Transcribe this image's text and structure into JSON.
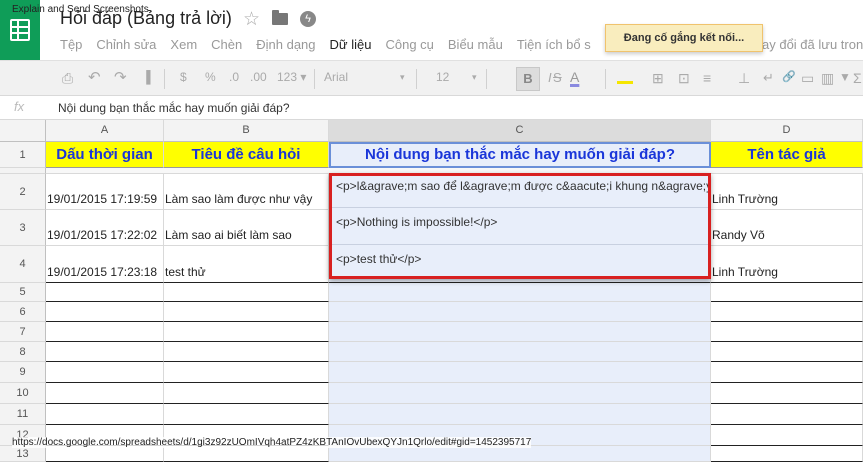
{
  "overlay_title": "Explain and Send Screenshots",
  "doc_title": "Hỏi đáp (Bảng trả lời)",
  "menu": [
    "Tệp",
    "Chỉnh sửa",
    "Xem",
    "Chèn",
    "Định dạng",
    "Dữ liệu",
    "Công cụ",
    "Biểu mẫu",
    "Tiện ích bổ s"
  ],
  "menu_active_index": 5,
  "menu_last": "ay đổi đã lưu trong",
  "toast": "Đang cố gắng kết nối...",
  "toolbar": {
    "print": "⎙",
    "undo": "↶",
    "redo": "↷",
    "paint": "▐",
    "currency": "$",
    "percent": "%",
    "dec_less": ".0",
    "dec_more": ".00",
    "format": "123 ▾",
    "font": "Arial",
    "font_dd": "▾",
    "size": "12",
    "size_dd": "▾",
    "bold": "B",
    "italic": "I",
    "strike": "S",
    "color": "A",
    "borders": "⊞",
    "merge": "⊡",
    "align": "≡",
    "valign": "⊥",
    "wrap": "↵",
    "link": "🔗",
    "comment": "▭",
    "chart": "▥",
    "filter": "▼",
    "func": "Σ"
  },
  "formula": {
    "fx": "fx",
    "text": "Nội dung bạn thắc mắc hay muốn giải đáp?"
  },
  "columns": [
    "A",
    "B",
    "C",
    "D"
  ],
  "rows": [
    "1",
    "2",
    "3",
    "4",
    "5",
    "6",
    "7",
    "8",
    "9",
    "10",
    "11",
    "12",
    "13"
  ],
  "headers": [
    "Dấu thời gian",
    "Tiêu đề câu hỏi",
    "Nội dung bạn thắc mắc hay muốn giải đáp?",
    "Tên tác giả"
  ],
  "data_rows": [
    {
      "a": "19/01/2015 17:19:59",
      "b": "Làm sao làm được như vậy",
      "d": "Linh Trường"
    },
    {
      "a": "19/01/2015 17:22:02",
      "b": "Làm sao ai biết làm sao",
      "d": "Randy Võ"
    },
    {
      "a": "19/01/2015 17:23:18",
      "b": "test thử",
      "d": "Linh Trường"
    }
  ],
  "popup_lines": [
    "<p>l&agrave;m sao để l&agrave;m được c&aacute;i khung n&agrave;y</p>",
    "<p>Nothing is impossible!</p>",
    "<p>test thử</p>"
  ],
  "status_url": "https://docs.google.com/spreadsheets/d/1gi3z92zUOmIVqh4atPZ4zKBTAnIOvUbexQYJn1Qrlo/edit#gid=1452395717"
}
